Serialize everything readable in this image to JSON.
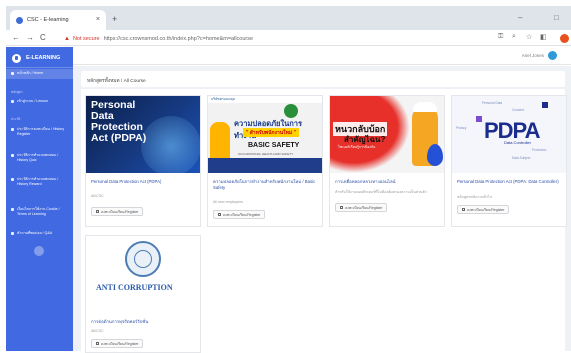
{
  "browser": {
    "tab_title": "CSC - E-learning",
    "tab_close": "×",
    "new_tab": "+",
    "window_controls": [
      "–",
      "□"
    ],
    "nav": [
      "←",
      "→",
      "C"
    ],
    "not_secure": "Not secure",
    "url": "https://csc.crownsmod.co.th/index.php?c=home&m=allcourse"
  },
  "sidebar": {
    "brand": "E-LEARNING",
    "items": [
      {
        "label": "หน้าหลัก / Home",
        "section": ""
      },
      {
        "label": "เข้าสู่ระบบ / Lesson",
        "section": "หลักสูตร"
      },
      {
        "label": "ประวัติการลงทะเบียน / History Register",
        "section": "ประวัติ"
      },
      {
        "label": "ประวัติการทำแบบทดสอบ / History Quiz",
        "section": ""
      },
      {
        "label": "ประวัติการทำแบบทดสอบ / History Reward",
        "section": ""
      },
      {
        "label": "เงื่อนไขการใช้งาน Cookie / Terms of Learning",
        "section": ""
      },
      {
        "label": "คำถามที่พบบ่อย / Q&A",
        "section": ""
      }
    ]
  },
  "topnav": {
    "user_name": "Ariel Jones"
  },
  "breadcrumb": "หลักสูตรทั้งหมด / All Course",
  "courses": [
    {
      "image_text": "Personal Data Protection Act (PDPA)",
      "title": "Personal Data Protection Act (PDPA)",
      "meta": "All/CSC",
      "button": "ลงทะเบียนเรียน/Register"
    },
    {
      "image_top": "บริษัทครอบคลุม",
      "image_line1": "ความปลอดภัยในการทำงาน",
      "image_line2": "\" สำหรับพนักงานใหม่ \"",
      "image_line3": "BASIC SAFETY",
      "image_sub": "OCCUPATIONAL HEALTH AND SAFETY",
      "title": "ความปลอดภัยในการทำงานสำหรับพนักงานใหม่ / Basic Safety",
      "meta": "All new employees",
      "button": "ลงทะเบียนเรียน/Register"
    },
    {
      "image_line1": "หนวกลับบ้อก",
      "image_line2": "สำคัญไฉน?",
      "image_line3": "ไซเบอร์เรียนรู้การป้องกัน",
      "title": "การเหยื่อหลอกหลวงทางออนไลน์",
      "meta": "สำหรับใช้งานคอมพิวเตอร์ที่ไม่ต้องคุ้มครองความเป็นส่วนตัว",
      "button": "ลงทะเบียนเรียน/Register"
    },
    {
      "image_big": "PDPA",
      "image_sub": "Data Controller",
      "image_words": [
        "Personal Data",
        "Consent",
        "Privacy",
        "Protection",
        "Data Subject"
      ],
      "title": "Personal Data Protection Act (PDPA: Data Controller)",
      "meta": "หลักสูตรพนักงานทั่วไป",
      "button": "ลงทะเบียนเรียน/Register"
    },
    {
      "image_text": "ANTI CORRUPTION",
      "title": "การต่อต้านการทุจริตคอร์รัปชั่น",
      "meta": "All/CSC",
      "button": "ลงทะเบียนเรียน/Register"
    }
  ],
  "colors": {
    "sidebar": "#4169e1",
    "link": "#2b4ea8",
    "background": "#eef1f5"
  }
}
